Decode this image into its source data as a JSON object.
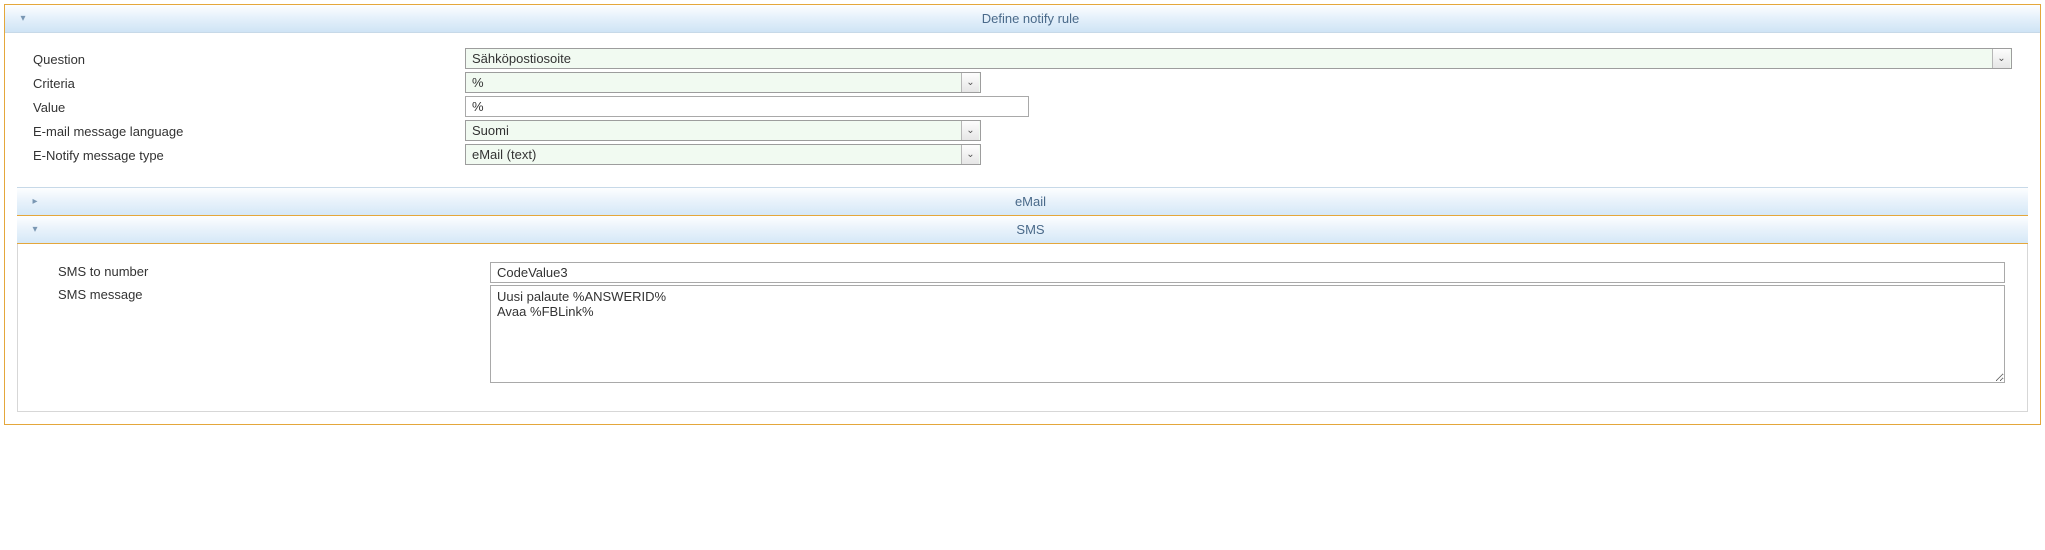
{
  "panel": {
    "title": "Define notify rule"
  },
  "form": {
    "question_label": "Question",
    "question_value": "Sähköpostiosoite",
    "criteria_label": "Criteria",
    "criteria_value": "%",
    "value_label": "Value",
    "value_value": "%",
    "email_lang_label": "E-mail message language",
    "email_lang_value": "Suomi",
    "notify_type_label": "E-Notify message type",
    "notify_type_value": "eMail (text)"
  },
  "sections": {
    "email_title": "eMail",
    "sms_title": "SMS"
  },
  "sms": {
    "to_label": "SMS to number",
    "to_value": "CodeValue3",
    "msg_label": "SMS message",
    "msg_value": "Uusi palaute %ANSWERID%\nAvaa %FBLink%"
  }
}
